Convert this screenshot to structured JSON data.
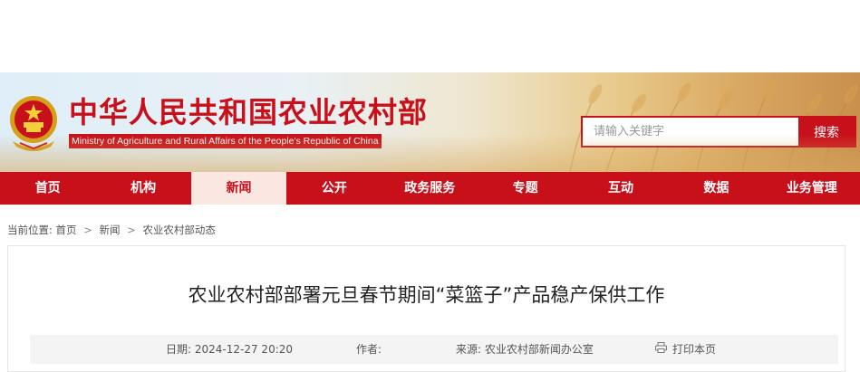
{
  "header": {
    "title_cn": "中华人民共和国农业农村部",
    "title_en": "Ministry of Agriculture and Rural Affairs of the People's Republic of China",
    "search": {
      "placeholder": "请输入关键字",
      "button_label": "搜索"
    }
  },
  "nav": {
    "items": [
      "首页",
      "机构",
      "新闻",
      "公开",
      "政务服务",
      "专题",
      "互动",
      "数据",
      "业务管理"
    ],
    "active_item": "新闻"
  },
  "breadcrumb": {
    "prefix": "当前位置:",
    "items": [
      "首页",
      "新闻",
      "农业农村部动态"
    ],
    "separator": ">"
  },
  "article": {
    "title": "农业农村部部署元旦春节期间“菜篮子”产品稳产保供工作",
    "date_label": "日期:",
    "date": "2024-12-27 20:20",
    "author_label": "作者:",
    "author": "",
    "source_label": "来源:",
    "source": "农业农村部新闻办公室",
    "print_label": "打印本页"
  },
  "colors": {
    "brand_red": "#c8101b",
    "nav_active_bg": "#fbe7e2",
    "meta_bg": "#f4f4f4"
  },
  "icons": {
    "emblem": "national-emblem",
    "print": "printer-icon"
  }
}
